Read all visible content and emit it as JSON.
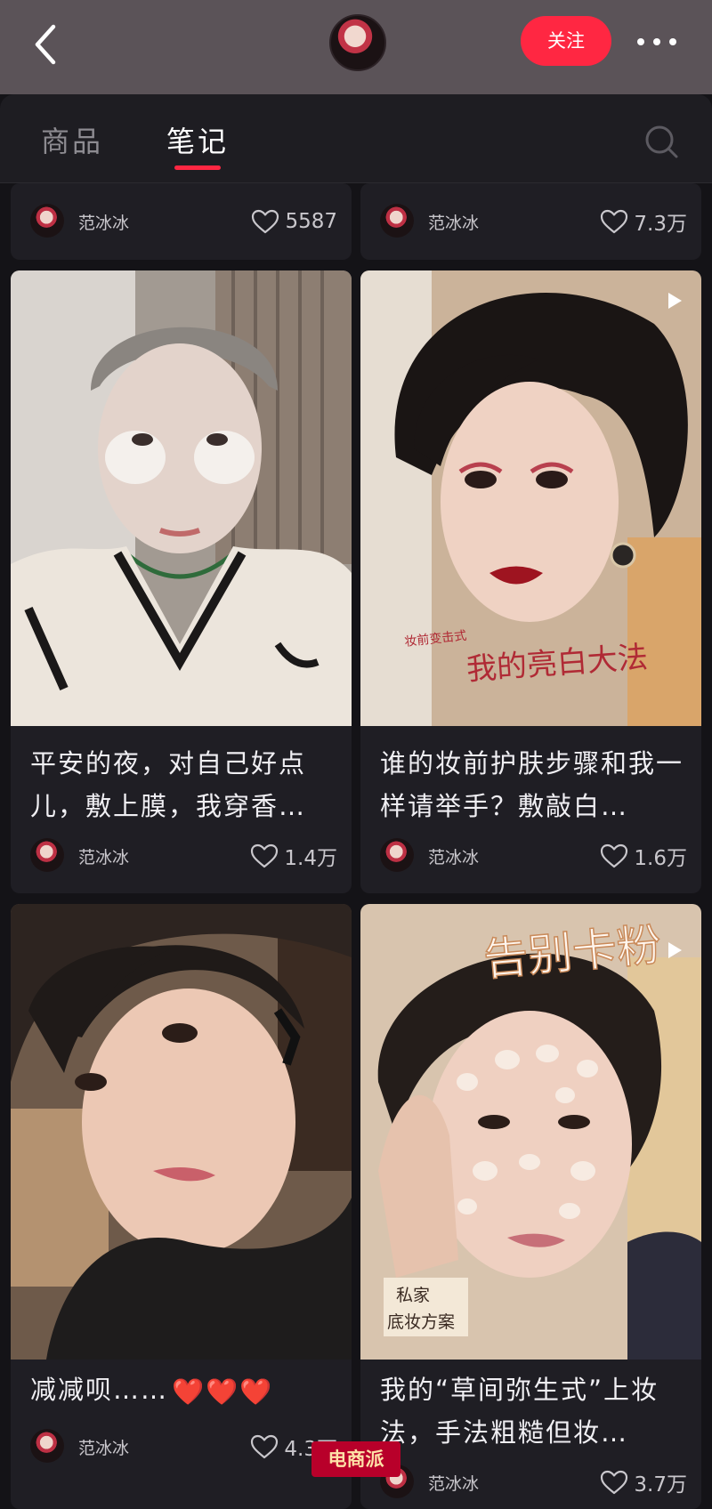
{
  "header": {
    "follow_label": "关注",
    "back_icon": "chevron-left-icon",
    "more_icon": "more-horizontal-icon"
  },
  "tabs": {
    "products_label": "商品",
    "notes_label": "笔记",
    "search_icon": "search-icon"
  },
  "colors": {
    "accent": "#ff2742",
    "topbar": "#5b5358",
    "card": "#1f1e24",
    "background": "#141317"
  },
  "notes": [
    {
      "author": "范冰冰",
      "likes": "5587"
    },
    {
      "author": "范冰冰",
      "likes": "7.3万"
    },
    {
      "title": "平安的夜，对自己好点儿，敷上膜，我穿香…",
      "author": "范冰冰",
      "likes": "1.4万"
    },
    {
      "title": "谁的妆前护肤步骤和我一样请举手？敷敲白…",
      "author": "范冰冰",
      "likes": "1.6万",
      "photo_text": {
        "tag": "妆前变击式",
        "caption": "我的亮白大法"
      }
    },
    {
      "title": "减减呗……",
      "title_emoji": "❤️❤️❤️",
      "author": "范冰冰",
      "likes": "4.3万"
    },
    {
      "title": "我的“草间弥生式”上妆法，手法粗糙但妆…",
      "author": "范冰冰",
      "likes": "3.7万",
      "photo_text": {
        "headline": "告别卡粉",
        "tag_line1": "私家",
        "tag_line2": "底妆方案"
      }
    }
  ],
  "watermark": "电商派"
}
